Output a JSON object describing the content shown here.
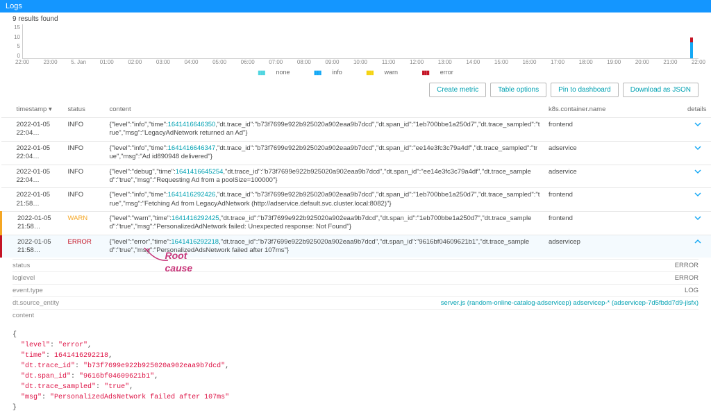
{
  "header": {
    "title": "Logs"
  },
  "results_count": "9 results found",
  "chart_data": {
    "type": "bar",
    "title": "",
    "xlabel": "",
    "ylabel": "",
    "ylim": [
      0,
      15
    ],
    "y_ticks": [
      "15",
      "10",
      "5",
      "0"
    ],
    "x_ticks": [
      "22:00",
      "23:00",
      "5. Jan",
      "01:00",
      "02:00",
      "03:00",
      "04:00",
      "05:00",
      "06:00",
      "07:00",
      "08:00",
      "09:00",
      "10:00",
      "11:00",
      "12:00",
      "13:00",
      "14:00",
      "15:00",
      "16:00",
      "17:00",
      "18:00",
      "19:00",
      "20:00",
      "21:00",
      "22:00"
    ],
    "legend": [
      "none",
      "info",
      "warn",
      "error"
    ],
    "bars": [
      {
        "pos_pct": 98.8,
        "info": 7,
        "error": 2
      }
    ]
  },
  "actions": {
    "create_metric": "Create metric",
    "table_options": "Table options",
    "pin": "Pin to dashboard",
    "download": "Download as JSON"
  },
  "columns": {
    "timestamp": "timestamp",
    "status": "status",
    "content": "content",
    "container": "k8s.container.name",
    "details": "details"
  },
  "rows": [
    {
      "ts": "2022-01-05 22:04…",
      "status": "INFO",
      "content_pre": "{\"level\":\"info\",\"time\":",
      "content_hl": "1641416646350",
      "content_post": ",\"dt.trace_id\":\"b73f7699e922b925020a902eaa9b7dcd\",\"dt.span_id\":\"1eb700bbe1a250d7\",\"dt.trace_sampled\":\"true\",\"msg\":\"LegacyAdNetwork returned an Ad\"}",
      "container": "frontend"
    },
    {
      "ts": "2022-01-05 22:04…",
      "status": "INFO",
      "content_pre": "{\"level\":\"info\",\"time\":",
      "content_hl": "1641416646347",
      "content_post": ",\"dt.trace_id\":\"b73f7699e922b925020a902eaa9b7dcd\",\"dt.span_id\":\"ee14e3fc3c79a4df\",\"dt.trace_sampled\":\"true\",\"msg\":\"Ad id890948 delivered\"}",
      "container": "adservice"
    },
    {
      "ts": "2022-01-05 22:04…",
      "status": "INFO",
      "content_pre": "{\"level\":\"debug\",\"time\":",
      "content_hl": "1641416645254",
      "content_post": ",\"dt.trace_id\":\"b73f7699e922b925020a902eaa9b7dcd\",\"dt.span_id\":\"ee14e3fc3c79a4df\",\"dt.trace_sampled\":\"true\",\"msg\":\"Requesting Ad from a poolSize=100000\"}",
      "container": "adservice"
    },
    {
      "ts": "2022-01-05 21:58…",
      "status": "INFO",
      "content_pre": "{\"level\":\"info\",\"time\":",
      "content_hl": "1641416292426",
      "content_post": ",\"dt.trace_id\":\"b73f7699e922b925020a902eaa9b7dcd\",\"dt.span_id\":\"1eb700bbe1a250d7\",\"dt.trace_sampled\":\"true\",\"msg\":\"Fetching Ad from LegacyAdNetwork (http://adservice.default.svc.cluster.local:8082)\"}",
      "container": "frontend"
    },
    {
      "ts": "2022-01-05 21:58…",
      "status": "WARN",
      "content_pre": "{\"level\":\"warn\",\"time\":",
      "content_hl": "1641416292425",
      "content_post": ",\"dt.trace_id\":\"b73f7699e922b925020a902eaa9b7dcd\",\"dt.span_id\":\"1eb700bbe1a250d7\",\"dt.trace_sampled\":\"true\",\"msg\":\"PersonalizedAdNetwork failed: Unexpected response: Not Found\"}",
      "container": "frontend"
    },
    {
      "ts": "2022-01-05 21:58…",
      "status": "ERROR",
      "content_pre": "{\"level\":\"error\",\"time\":",
      "content_hl": "1641416292218",
      "content_post": ",\"dt.trace_id\":\"b73f7699e922b925020a902eaa9b7dcd\",\"dt.span_id\":\"9616bf04609621b1\",\"dt.trace_sampled\":\"true\",\"msg\":\"PersonalizedAdsNetwork failed after 107ms\"}",
      "container": "adservicep",
      "expanded": true
    }
  ],
  "annotation": {
    "label": "Root cause"
  },
  "details": {
    "kv": [
      {
        "k": "status",
        "v": "ERROR"
      },
      {
        "k": "loglevel",
        "v": "ERROR"
      },
      {
        "k": "event.type",
        "v": "LOG"
      },
      {
        "k": "dt.source_entity",
        "v": "server.js (random-online-catalog-adservicep) adservicep-* (adservicep-7d5fbdd7d9-jlsfx)",
        "link": true
      }
    ],
    "content_label": "content",
    "code": {
      "open": "{",
      "lines": [
        {
          "k": "\"level\"",
          "v": "\"error\""
        },
        {
          "k": "\"time\"",
          "v": "1641416292218"
        },
        {
          "k": "\"dt.trace_id\"",
          "v": "\"b73f7699e922b925020a902eaa9b7dcd\""
        },
        {
          "k": "\"dt.span_id\"",
          "v": "\"9616bf04609621b1\""
        },
        {
          "k": "\"dt.trace_sampled\"",
          "v": "\"true\""
        },
        {
          "k": "\"msg\"",
          "v": "\"PersonalizedAdsNetwork failed after 107ms\""
        }
      ],
      "close": "}"
    }
  }
}
